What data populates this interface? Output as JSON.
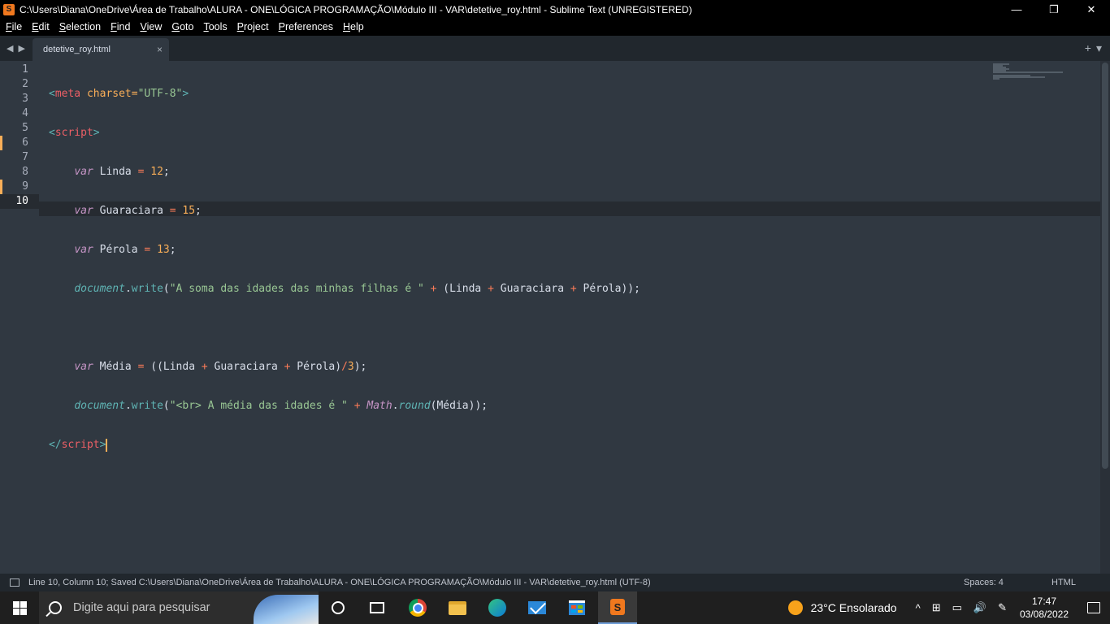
{
  "window": {
    "title": "C:\\Users\\Diana\\OneDrive\\Área de Trabalho\\ALURA - ONE\\LÓGICA PROGRAMAÇÃO\\Módulo III - VAR\\detetive_roy.html - Sublime Text (UNREGISTERED)",
    "minimize": "—",
    "maximize": "❐",
    "close": "✕"
  },
  "menu": [
    "File",
    "Edit",
    "Selection",
    "Find",
    "View",
    "Goto",
    "Tools",
    "Project",
    "Preferences",
    "Help"
  ],
  "tab": {
    "name": "detetive_roy.html",
    "close": "×"
  },
  "tabbar_nav": "◀▶",
  "tabbar_right": {
    "add": "+",
    "dropdown": "▾"
  },
  "line_numbers": [
    "1",
    "2",
    "3",
    "4",
    "5",
    "6",
    "7",
    "8",
    "9",
    "10"
  ],
  "code": {
    "l1": {
      "open": "<",
      "tag": "meta",
      "attr": " charset=",
      "val": "\"UTF-8\"",
      "close": ">"
    },
    "l2": {
      "open": "<",
      "tag": "script",
      "close": ">"
    },
    "l3": {
      "indent": "    ",
      "kw": "var",
      "name": " Linda ",
      "op": "=",
      "num": " 12",
      "end": ";"
    },
    "l4": {
      "indent": "    ",
      "kw": "var",
      "name": " Guaraciara ",
      "op": "=",
      "num": " 15",
      "end": ";"
    },
    "l5": {
      "indent": "    ",
      "kw": "var",
      "name": " Pérola ",
      "op": "=",
      "num": " 13",
      "end": ";"
    },
    "l6": {
      "indent": "    ",
      "obj": "document",
      "dot": ".",
      "fn": "write",
      "p1": "(",
      "str": "\"A soma das idades das minhas filhas é \"",
      "op1": " + ",
      "p2": "(Linda ",
      "op2": "+",
      "p3": " Guaraciara ",
      "op3": "+",
      "p4": " Pérola));"
    },
    "l8": {
      "indent": "    ",
      "kw": "var",
      "name": " Média ",
      "op": "=",
      "p1": " ((Linda ",
      "op2": "+",
      "p2": " Guaraciara ",
      "op3": "+",
      "p3": " Pérola)",
      "op4": "/",
      "num": "3",
      "end": ");"
    },
    "l9": {
      "indent": "    ",
      "obj": "document",
      "dot": ".",
      "fn": "write",
      "p1": "(",
      "str": "\"<br> A média das idades é \"",
      "op1": " + ",
      "obj2": "Math",
      "dot2": ".",
      "fn2": "round",
      "p2": "(Média));"
    },
    "l10": {
      "open": "</",
      "tag": "script",
      "close": ">"
    }
  },
  "status": {
    "message": "Line 10, Column 10; Saved C:\\Users\\Diana\\OneDrive\\Área de Trabalho\\ALURA - ONE\\LÓGICA PROGRAMAÇÃO\\Módulo III - VAR\\detetive_roy.html (UTF-8)",
    "spaces": "Spaces: 4",
    "syntax": "HTML"
  },
  "taskbar": {
    "search_placeholder": "Digite aqui para pesquisar",
    "weather": "23°C  Ensolarado",
    "time": "17:47",
    "date": "03/08/2022",
    "sys_icons": [
      "^",
      "⊞",
      "▭",
      "🔊",
      "✎"
    ]
  },
  "colors": {
    "background": "#303841",
    "tag": "#ec5f66",
    "string": "#99c794",
    "number": "#f9ae58",
    "keyword": "#c695c6",
    "function": "#5fb4b4"
  }
}
